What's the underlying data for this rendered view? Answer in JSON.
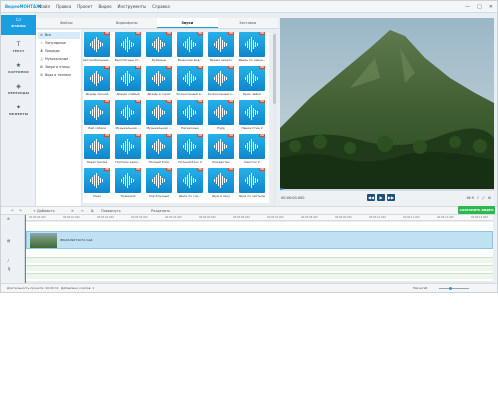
{
  "app": {
    "logo": "ВидеоМОНТАЖ"
  },
  "menu": [
    "Файл",
    "Правка",
    "Проект",
    "Видео",
    "Инструменты",
    "Справка"
  ],
  "window_buttons": [
    "—",
    "□",
    "✕"
  ],
  "sidebar": [
    {
      "label": "ФАЙЛЫ",
      "icon": "folder-icon",
      "glyph": "▭"
    },
    {
      "label": "ТЕКСТ",
      "icon": "text-icon",
      "glyph": "T"
    },
    {
      "label": "КАРТИНКИ",
      "icon": "star-icon",
      "glyph": "★"
    },
    {
      "label": "ПЕРЕХОДЫ",
      "icon": "transition-icon",
      "glyph": "◈"
    },
    {
      "label": "ЭФФЕКТЫ",
      "icon": "effects-icon",
      "glyph": "✦"
    }
  ],
  "tabs": [
    "Файлы",
    "Видеофоны",
    "Звуки",
    "Заставки"
  ],
  "categories": [
    {
      "label": "Все",
      "glyph": "≡"
    },
    {
      "label": "Популярные",
      "glyph": "☆"
    },
    {
      "label": "Природа",
      "glyph": "♣"
    },
    {
      "label": "Музыкальные",
      "glyph": "♫"
    },
    {
      "label": "Звери и птицы",
      "glyph": "✿"
    },
    {
      "label": "Вода и техника",
      "glyph": "⚙"
    }
  ],
  "sounds": [
    "Автомобильные...",
    "Бесплатные от...",
    "Бубенцы",
    "Воинские вод...",
    "Время начало",
    "Дверь по крыш...",
    "Дождь лесной",
    "Дождь слабый",
    "Дождь в горах",
    "Колокольный в...",
    "Колокольный з...",
    "Крик чайки",
    "Лай собаки",
    "Музыкальная ...",
    "Музыкальная ...",
    "Насекомые",
    "Пурр",
    "Пение птиц 2",
    "Перестрелка",
    "Плотник ремо...",
    "Полный блок",
    "Полный блок 2",
    "Рождество",
    "Свисток 2",
    "Смех",
    "Травяной",
    "Хор блузный",
    "Шаги по гор...",
    "Шум в лесу",
    "Шум по листьям"
  ],
  "player": {
    "time": "00:00:00.000",
    "buttons": [
      "◀◀",
      "▶",
      "▶▶"
    ],
    "ratio": "16:9",
    "extra": [
      "♪",
      "⤢",
      "⚙"
    ]
  },
  "toolbar": {
    "add": "+ Добавить",
    "rotate": "Повернуть",
    "undo": "↶",
    "redo": "↷",
    "delete": "✕",
    "cut": "✂",
    "copy": "⧉",
    "split": "Разделить",
    "export": "СОХРАНИТЬ ВИДЕО"
  },
  "ruler": [
    "00:00:00.000",
    "00:00:01.000",
    "00:00:02.000",
    "00:00:03.000",
    "00:00:04.000",
    "00:00:05.000",
    "00:00:06.000",
    "00:00:07.000",
    "00:00:08.000",
    "00:00:09.000",
    "00:00:10.000",
    "00:00:11.000",
    "00:00:12.000",
    "00:00:13.000"
  ],
  "clip": {
    "name": "IMG0109071072.mp4"
  },
  "status": {
    "duration": "Длительность проекта: 00:00:11",
    "clips": "Добавлено клипов: 1",
    "scale": "Масштаб:"
  },
  "colors": {
    "accent": "#1a9ee0",
    "export": "#2db84d",
    "thumb": "#27b1e8",
    "hd_badge": "#e0442f"
  }
}
